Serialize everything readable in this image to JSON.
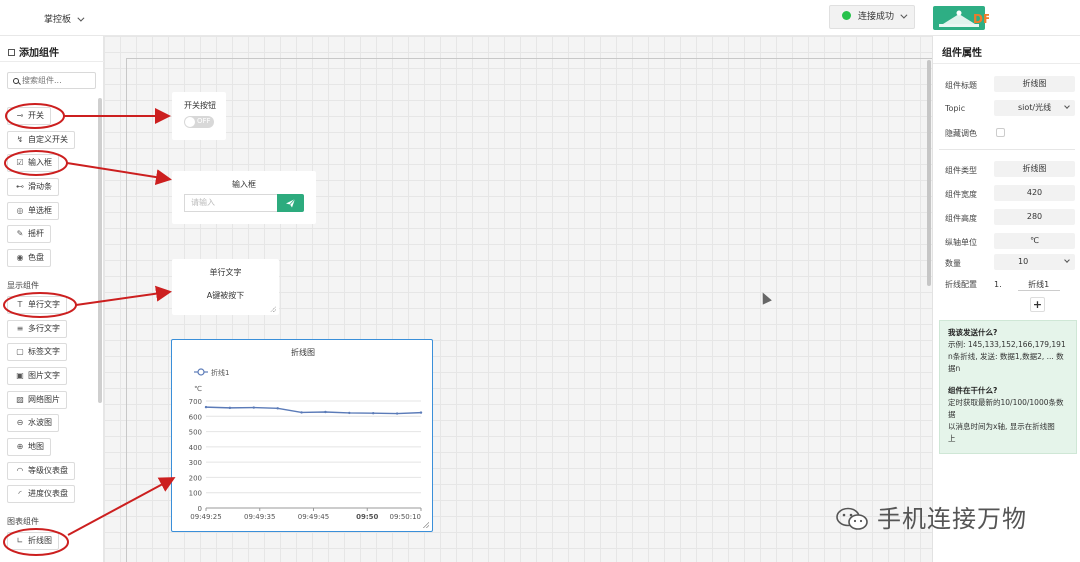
{
  "topbar": {
    "dashboard_menu": "掌控板",
    "connection_status": "连接成功",
    "status_color": "#27c24c",
    "logo_text": "DF"
  },
  "left_panel": {
    "title": "添加组件",
    "search_placeholder": "搜索组件...",
    "control_items": [
      {
        "icon": "toggle-icon",
        "label": "开关"
      },
      {
        "icon": "custom-switch-icon",
        "label": "自定义开关"
      },
      {
        "icon": "input-box-icon",
        "label": "输入框"
      },
      {
        "icon": "slider-icon",
        "label": "滑动条"
      },
      {
        "icon": "radio-icon",
        "label": "单选框"
      },
      {
        "icon": "joystick-icon",
        "label": "摇杆"
      },
      {
        "icon": "color-wheel-icon",
        "label": "色盘"
      }
    ],
    "display_section": "显示组件",
    "display_items": [
      {
        "icon": "text-line-icon",
        "label": "单行文字"
      },
      {
        "icon": "multiline-text-icon",
        "label": "多行文字"
      },
      {
        "icon": "label-text-icon",
        "label": "标签文字"
      },
      {
        "icon": "image-text-icon",
        "label": "图片文字"
      },
      {
        "icon": "web-image-icon",
        "label": "网络图片"
      },
      {
        "icon": "water-wave-icon",
        "label": "水波图"
      },
      {
        "icon": "map-icon",
        "label": "地图"
      },
      {
        "icon": "gauge-icon",
        "label": "等级仪表盘"
      },
      {
        "icon": "progress-gauge-icon",
        "label": "进度仪表盘"
      }
    ],
    "chart_section": "图表组件",
    "chart_items": [
      {
        "icon": "line-chart-icon",
        "label": "折线图"
      }
    ]
  },
  "canvas": {
    "switch_widget": {
      "title": "开关按钮",
      "state": "OFF"
    },
    "input_widget": {
      "title": "输入框",
      "placeholder": "请输入"
    },
    "text_widget": {
      "title": "单行文字",
      "value": "A键被按下"
    },
    "chart_widget": {
      "title": "折线图"
    }
  },
  "chart_data": {
    "type": "line",
    "title": "折线图",
    "xlabel": "",
    "ylabel": "℃",
    "ylim": [
      0,
      700
    ],
    "yticks": [
      0,
      100,
      200,
      300,
      400,
      500,
      600,
      700
    ],
    "xtick_labels": [
      "09:49:25",
      "09:49:35",
      "09:49:45",
      "09:50",
      "09:50:10"
    ],
    "legend": "top-left",
    "grid": true,
    "series": [
      {
        "name": "折线1",
        "color": "#5b7bb8",
        "values": [
          660,
          655,
          657,
          652,
          625,
          628,
          622,
          620,
          618,
          624
        ]
      }
    ]
  },
  "right_panel": {
    "title": "组件属性",
    "props": [
      {
        "label": "组件标题",
        "value": "折线图"
      },
      {
        "label": "Topic",
        "value": "siot/光线"
      },
      {
        "label": "隐藏调色",
        "value": ""
      },
      {
        "label": "组件类型",
        "value": "折线图"
      },
      {
        "label": "组件宽度",
        "value": "420"
      },
      {
        "label": "组件高度",
        "value": "280"
      },
      {
        "label": "纵轴单位",
        "value": "℃"
      },
      {
        "label": "数量",
        "value": "10"
      },
      {
        "label": "折线配置",
        "value": "1."
      }
    ],
    "series_name": "折线1",
    "add_label": "+",
    "help": {
      "q1": "我该发送什么?",
      "a1_line1": "示例: 145,133,152,166,179,191",
      "a1_line2": "n条折线, 发送: 数据1,数据2, ... 数",
      "a1_line3": "据n",
      "q2": "组件在干什么?",
      "a2_line1": "定时获取最新的10/100/1000条数",
      "a2_line2": "据",
      "a2_line3": "以消息时间为x轴, 显示在折线图",
      "a2_line4": "上"
    }
  },
  "watermark": {
    "text": "手机连接万物"
  },
  "colors": {
    "accent_green": "#2dab7e",
    "annotation_red": "#cc1f1f",
    "chart_border": "#3a8fd9"
  }
}
